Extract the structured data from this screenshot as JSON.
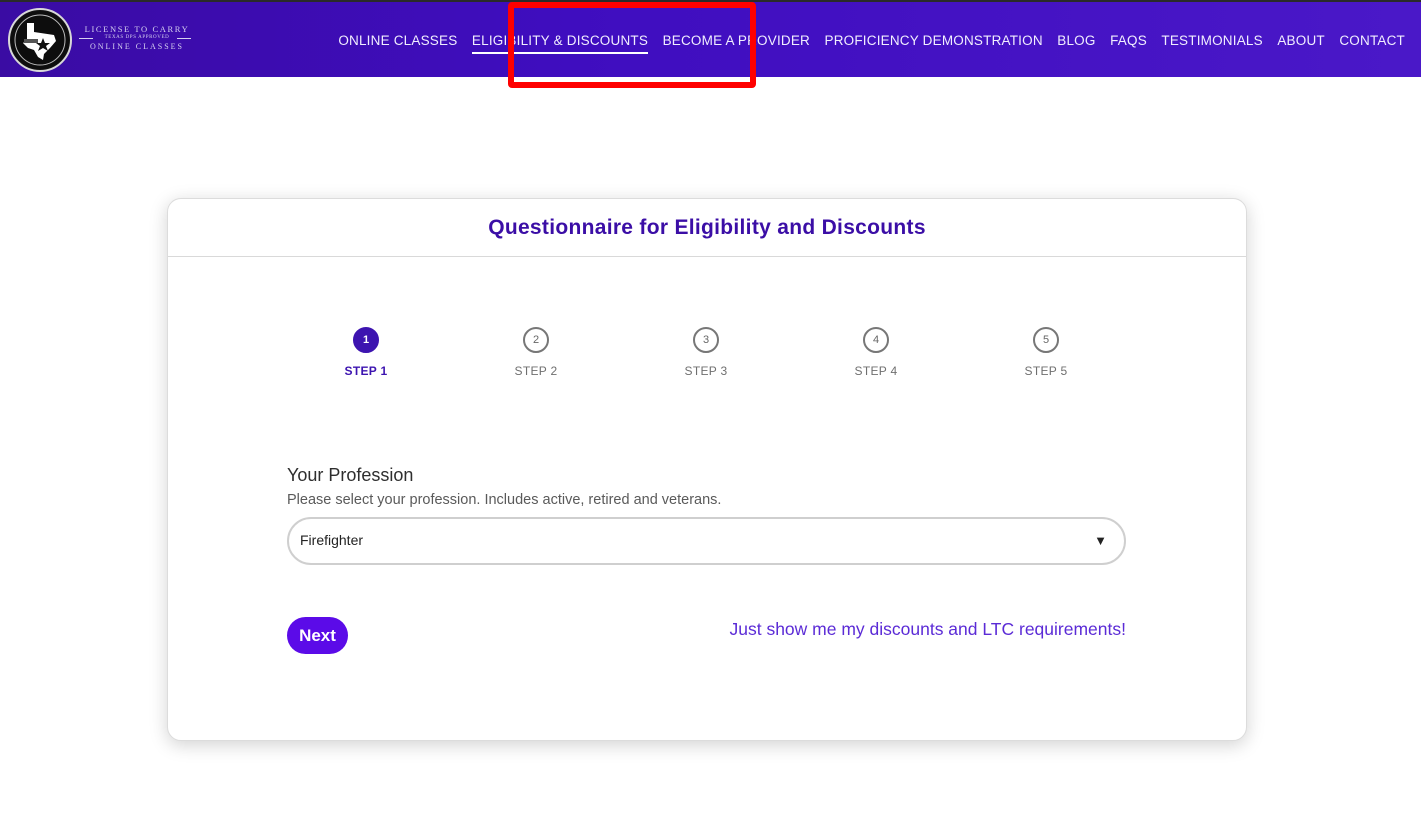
{
  "header": {
    "brand": {
      "line1": "LICENSE TO CARRY",
      "line2": "TEXAS DPS APPROVED",
      "line3": "ONLINE CLASSES"
    },
    "nav": [
      {
        "label": "ONLINE CLASSES"
      },
      {
        "label": "ELIGIBILITY & DISCOUNTS"
      },
      {
        "label": "BECOME A PROVIDER"
      },
      {
        "label": "PROFICIENCY DEMONSTRATION"
      },
      {
        "label": "BLOG"
      },
      {
        "label": "FAQS"
      },
      {
        "label": "TESTIMONIALS"
      },
      {
        "label": "ABOUT"
      },
      {
        "label": "CONTACT"
      }
    ],
    "active_nav": "ELIGIBILITY & DISCOUNTS"
  },
  "card": {
    "title": "Questionnaire for Eligibility and Discounts",
    "steps": [
      {
        "number": "1",
        "label": "STEP 1",
        "active": true
      },
      {
        "number": "2",
        "label": "STEP 2",
        "active": false
      },
      {
        "number": "3",
        "label": "STEP 3",
        "active": false
      },
      {
        "number": "4",
        "label": "STEP 4",
        "active": false
      },
      {
        "number": "5",
        "label": "STEP 5",
        "active": false
      }
    ],
    "profession": {
      "label": "Your Profession",
      "help": "Please select your profession. Includes active, retired and veterans.",
      "selected": "Firefighter",
      "caret_icon": "▼"
    },
    "next_label": "Next",
    "skip_link": "Just show me my discounts and LTC requirements!"
  },
  "colors": {
    "header_bg": "#3f0dbf",
    "accent": "#3d14b0",
    "button": "#5b0be8",
    "highlight": "#ff0000"
  }
}
